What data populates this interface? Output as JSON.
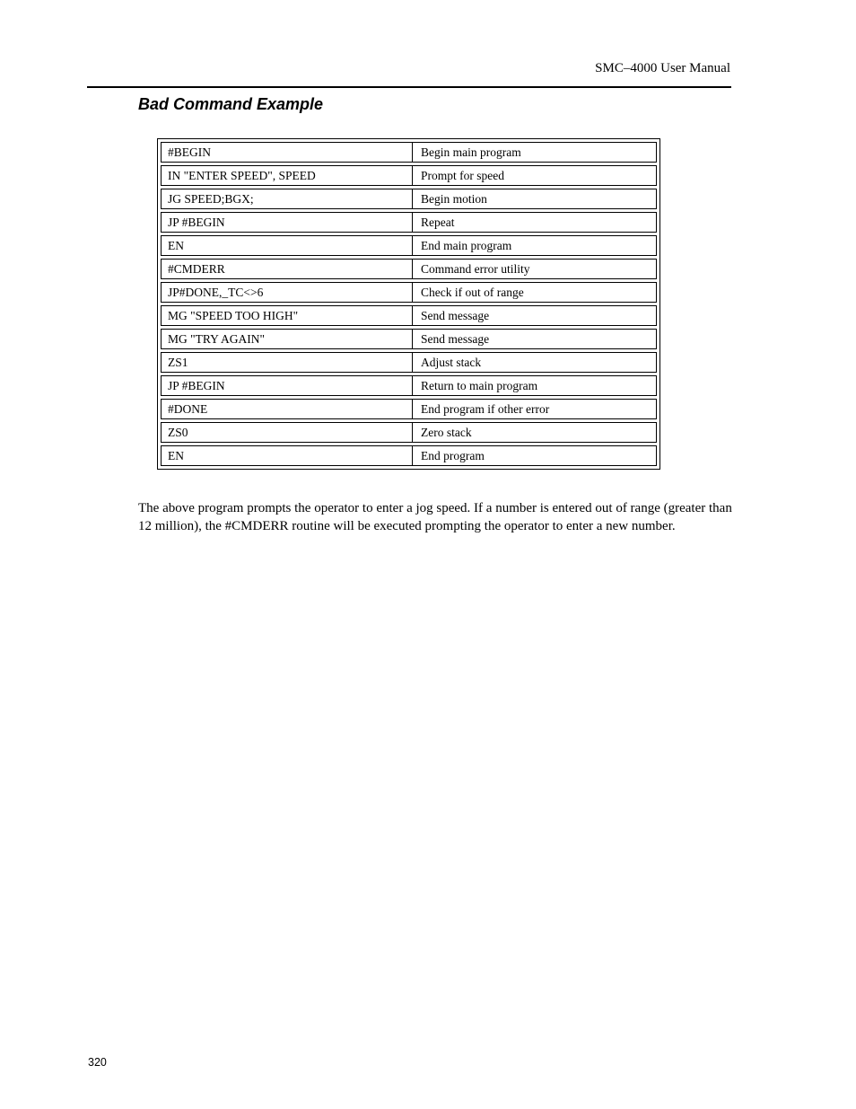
{
  "header": {
    "running_title": "SMC–4000 User Manual"
  },
  "section": {
    "title": "Bad Command Example"
  },
  "program": {
    "rows": [
      {
        "command": "#BEGIN",
        "description": "Begin main program"
      },
      {
        "command": "IN \"ENTER SPEED\", SPEED",
        "description": "Prompt for speed"
      },
      {
        "command": "JG SPEED;BGX;",
        "description": "Begin motion"
      },
      {
        "command": "JP #BEGIN",
        "description": "Repeat"
      },
      {
        "command": "EN",
        "description": "End main program"
      },
      {
        "command": "#CMDERR",
        "description": "Command error utility"
      },
      {
        "command": "JP#DONE,_TC<>6",
        "description": "Check if out of range"
      },
      {
        "command": "MG \"SPEED TOO HIGH\"",
        "description": "Send message"
      },
      {
        "command": "MG \"TRY AGAIN\"",
        "description": "Send message"
      },
      {
        "command": "ZS1",
        "description": "Adjust stack"
      },
      {
        "command": "JP #BEGIN",
        "description": "Return to main program"
      },
      {
        "command": "#DONE",
        "description": "End program if other error"
      },
      {
        "command": "ZS0",
        "description": "Zero stack"
      },
      {
        "command": "EN",
        "description": "End program"
      }
    ]
  },
  "body": {
    "paragraph": "The above program prompts the operator to enter a jog speed. If a number is entered out of range (greater than 12 million), the #CMDERR routine will be executed prompting the operator to enter a new number."
  },
  "footer": {
    "page_number": "320"
  }
}
